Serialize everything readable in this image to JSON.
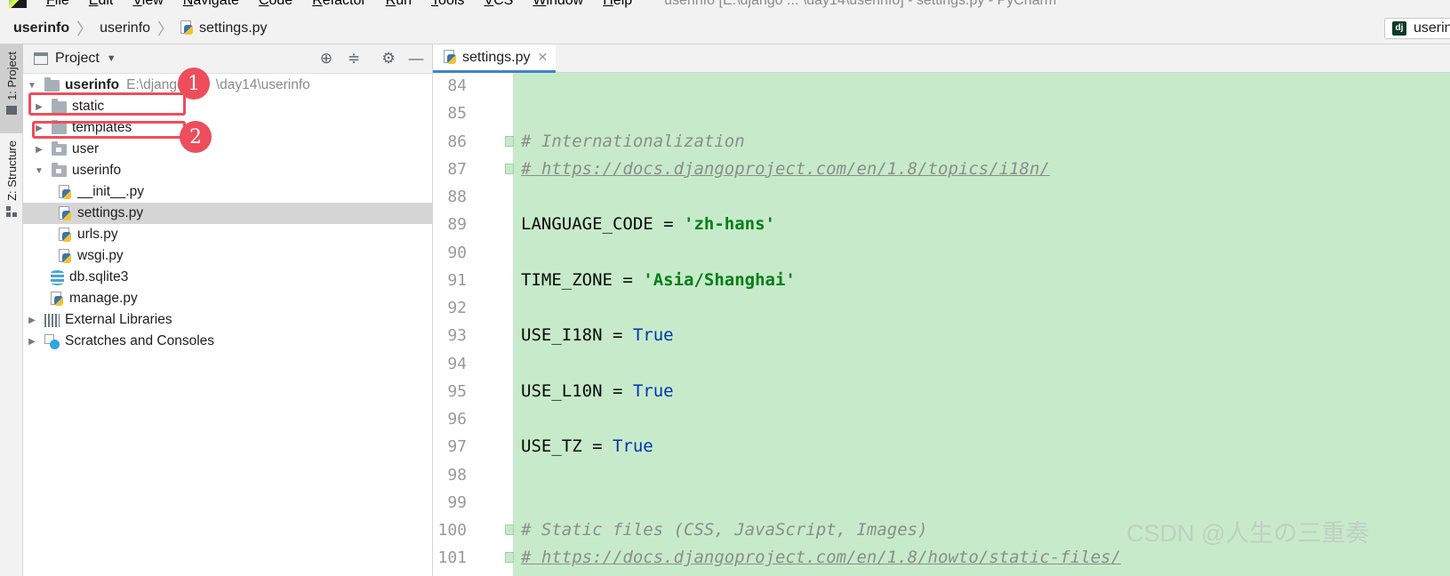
{
  "menubar": {
    "items": [
      {
        "mnemonic": "F",
        "rest": "ile"
      },
      {
        "mnemonic": "E",
        "rest": "dit"
      },
      {
        "mnemonic": "V",
        "rest": "iew"
      },
      {
        "mnemonic": "N",
        "rest": "avigate"
      },
      {
        "mnemonic": "C",
        "rest": "ode"
      },
      {
        "mnemonic": "R",
        "rest": "efactor"
      },
      {
        "mnemonic": "R",
        "rest": "un"
      },
      {
        "mnemonic": "T",
        "rest": "ools"
      },
      {
        "mnemonic": "V",
        "rest": "CS"
      },
      {
        "mnemonic": "W",
        "rest": "indow"
      },
      {
        "mnemonic": "H",
        "rest": "elp"
      }
    ],
    "window_title": "userinfo [E:\\django ... \\day14\\userinfo] - settings.py - PyCharm"
  },
  "breadcrumb": {
    "items": [
      "userinfo",
      "userinfo",
      "settings.py"
    ],
    "run_config": "userin"
  },
  "toolstrip": {
    "project_tab": "1: Project",
    "structure_tab": "Z: Structure"
  },
  "project_panel": {
    "title": "Project",
    "root_name": "userinfo",
    "root_path": "E:\\djangc",
    "root_path_tail": "\\day14\\userinfo",
    "items": {
      "static": "static",
      "templates": "templates",
      "user": "user",
      "userinfo_pkg": "userinfo",
      "init": "__init__.py",
      "settings": "settings.py",
      "urls": "urls.py",
      "wsgi": "wsgi.py",
      "db": "db.sqlite3",
      "manage": "manage.py",
      "external": "External Libraries",
      "scratches": "Scratches and Consoles"
    }
  },
  "annotations": {
    "marker_1": "1",
    "marker_2": "2"
  },
  "editor": {
    "tab_label": "settings.py",
    "lines": [
      {
        "n": "84"
      },
      {
        "n": "85"
      },
      {
        "n": "86",
        "comment": "# Internationalization"
      },
      {
        "n": "87",
        "link": "# https://docs.djangoproject.com/en/1.8/topics/i18n/"
      },
      {
        "n": "88"
      },
      {
        "n": "89",
        "plain": "LANGUAGE_CODE = ",
        "str": "'zh-hans'"
      },
      {
        "n": "90"
      },
      {
        "n": "91",
        "plain": "TIME_ZONE = ",
        "str": "'Asia/Shanghai'"
      },
      {
        "n": "92"
      },
      {
        "n": "93",
        "plain": "USE_I18N = ",
        "kw": "True"
      },
      {
        "n": "94"
      },
      {
        "n": "95",
        "plain": "USE_L10N = ",
        "kw": "True"
      },
      {
        "n": "96"
      },
      {
        "n": "97",
        "plain": "USE_TZ = ",
        "kw": "True"
      },
      {
        "n": "98"
      },
      {
        "n": "99"
      },
      {
        "n": "100",
        "comment": "# Static files (CSS, JavaScript, Images)"
      },
      {
        "n": "101",
        "link": "# https://docs.djangoproject.com/en/1.8/howto/static-files/"
      }
    ]
  },
  "watermark": "CSDN @人生の三重奏",
  "colors": {
    "highlight": "#ee4d5b",
    "code_bg": "#c7ebca",
    "string": "#067d17",
    "keyword": "#0033b3",
    "selection": "#d5d5d5"
  }
}
